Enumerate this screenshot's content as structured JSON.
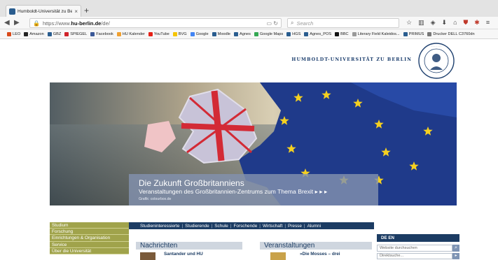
{
  "browser": {
    "tab_title": "Humboldt-Universität zu Be",
    "tab_close": "×",
    "new_tab": "+",
    "url_prefix": "https://www.",
    "url_domain": "hu-berlin.de",
    "url_path": "/de/",
    "search_placeholder": "Search",
    "bookmarks": [
      {
        "label": "LEO",
        "color": "#d94a1a"
      },
      {
        "label": "Amazon",
        "color": "#222222"
      },
      {
        "label": "GBZ",
        "color": "#2a5d8f"
      },
      {
        "label": "SPIEGEL",
        "color": "#d0232a"
      },
      {
        "label": "Facebook",
        "color": "#3b5998"
      },
      {
        "label": "HU Kalender",
        "color": "#f0a030"
      },
      {
        "label": "YouTube",
        "color": "#e62117"
      },
      {
        "label": "BVG",
        "color": "#f5c400"
      },
      {
        "label": "Google",
        "color": "#4285f4"
      },
      {
        "label": "Moodle",
        "color": "#2a5d8f"
      },
      {
        "label": "Agnes",
        "color": "#2a5d8f"
      },
      {
        "label": "Google Maps",
        "color": "#34a853"
      },
      {
        "label": "HGS",
        "color": "#2a5d8f"
      },
      {
        "label": "Agnes_POS",
        "color": "#2a5d8f"
      },
      {
        "label": "BBC",
        "color": "#111111"
      },
      {
        "label": "Literary Field Kaleidos...",
        "color": "#999999"
      },
      {
        "label": "PRIMUS",
        "color": "#2a5d8f"
      },
      {
        "label": "Drucker DELL C3760dn",
        "color": "#777777"
      }
    ]
  },
  "site": {
    "logo_text": "HUMBOLDT-UNIVERSITÄT ZU BERLIN",
    "hero": {
      "title": "Die Zukunft Großbritanniens",
      "subtitle": "Veranstaltungen des Großbritannien-Zentrums zum Thema Brexit ▸ ▸ ▸",
      "credit": "Grafik: colourbox.de"
    },
    "sidebar": [
      "Studium",
      "Forschung",
      "Einrichtungen & Organisation",
      "Service",
      "Über die Universität"
    ],
    "audience_nav": [
      "Studieninteressierte",
      "Studierende",
      "Schule",
      "Forschende",
      "Wirtschaft",
      "Presse",
      "Alumni"
    ],
    "news_heading": "Nachrichten",
    "news_item": "Santander und HU",
    "events_heading": "Veranstaltungen",
    "event_item": "»Die Mosses – drei",
    "lang_bar": "DE  EN",
    "search_placeholder": "Website durchsuchen",
    "directory_placeholder": "Direktsuche..."
  }
}
